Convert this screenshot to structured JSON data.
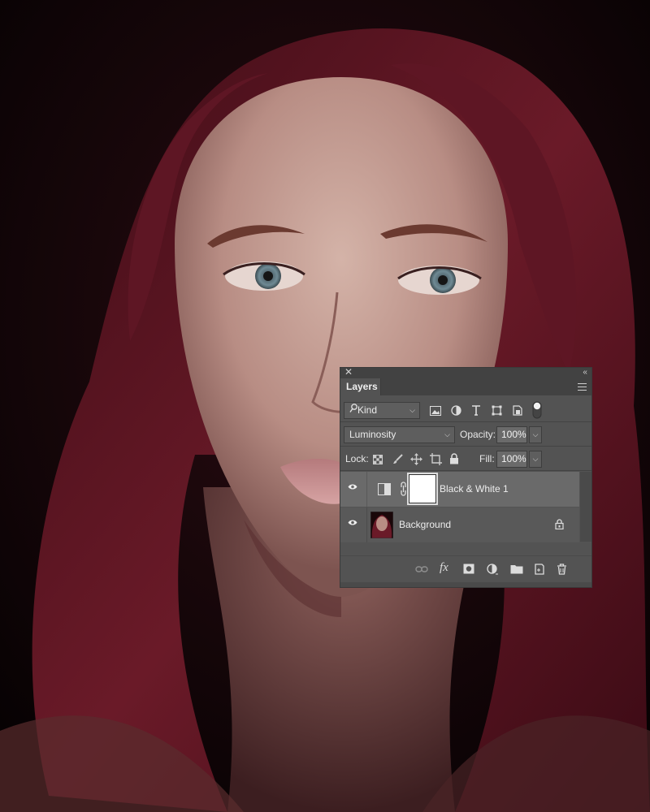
{
  "panel": {
    "tab_label": "Layers",
    "filter": {
      "kind_label": "Kind",
      "icons": [
        "image-filter-icon",
        "adjustment-filter-icon",
        "type-filter-icon",
        "shape-filter-icon",
        "smart-object-filter-icon",
        "filter-toggle-icon"
      ]
    },
    "blend_mode": "Luminosity",
    "opacity_label": "Opacity:",
    "opacity_value": "100%",
    "lock_label": "Lock:",
    "fill_label": "Fill:",
    "fill_value": "100%",
    "layers": [
      {
        "name": "Black & White 1",
        "type": "adjustment",
        "visible": true,
        "selected": true
      },
      {
        "name": "Background",
        "type": "image",
        "visible": true,
        "locked": true
      }
    ],
    "bottom_icons": [
      "link-layers-icon",
      "fx-icon",
      "add-mask-icon",
      "new-adjustment-icon",
      "new-group-icon",
      "new-layer-icon",
      "delete-layer-icon"
    ],
    "fx_label": "fx"
  },
  "colors": {
    "panel_bg": "#535353",
    "selected_row": "#6a6a6a",
    "hair": "#5a1420"
  }
}
